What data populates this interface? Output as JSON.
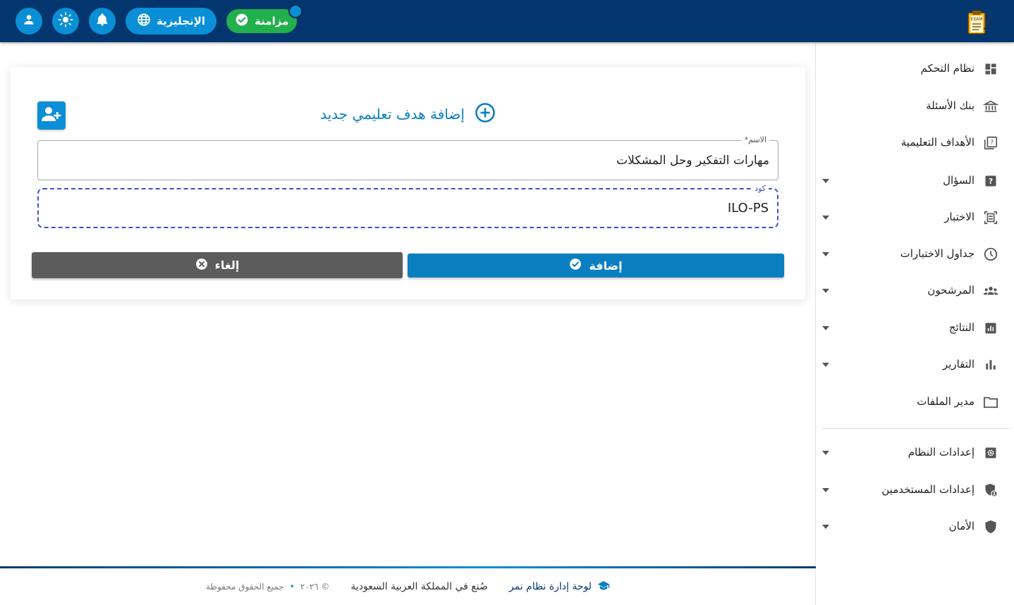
{
  "header": {
    "sync_label": "مزامنة",
    "language_label": "الإنجليزية",
    "icons": [
      "user-icon",
      "sun-icon",
      "bell-icon",
      "globe-icon",
      "check-circle-icon"
    ]
  },
  "sidebar": {
    "items": [
      {
        "label": "نظام التحكم",
        "icon": "dashboard-icon",
        "has_submenu": false
      },
      {
        "label": "بنك الأسئلة",
        "icon": "bank-icon",
        "has_submenu": false
      },
      {
        "label": "الأهداف التعليمية",
        "icon": "book-question-icon",
        "has_submenu": false
      },
      {
        "label": "السؤال",
        "icon": "question-icon",
        "has_submenu": true
      },
      {
        "label": "الاختبار",
        "icon": "exam-icon",
        "has_submenu": true
      },
      {
        "label": "جداول الاختبارات",
        "icon": "clock-icon",
        "has_submenu": true
      },
      {
        "label": "المرشحون",
        "icon": "group-icon",
        "has_submenu": true
      },
      {
        "label": "النتائج",
        "icon": "results-chart-icon",
        "has_submenu": true
      },
      {
        "label": "التقارير",
        "icon": "bar-chart-icon",
        "has_submenu": true
      },
      {
        "label": "مدير الملفات",
        "icon": "folder-icon",
        "has_submenu": false
      },
      {
        "label": "إعدادات النظام",
        "icon": "gear-icon",
        "has_submenu": true
      },
      {
        "label": "إعدادات المستخدمين",
        "icon": "user-shield-icon",
        "has_submenu": true
      },
      {
        "label": "الأمان",
        "icon": "shield-icon",
        "has_submenu": true
      }
    ]
  },
  "form": {
    "title": "إضافة هدف تعليمي جديد",
    "name_label": "الاسم*",
    "name_value": "مهارات التفكير وحل المشكلات",
    "code_label": "كود",
    "code_value": "ILO-PS",
    "add_label": "إضافة",
    "cancel_label": "إلغاء"
  },
  "footer": {
    "brand": "لوحة إدارة نظام نمر",
    "made_in": "صُنع في المملكة العربية السعودية",
    "year": "© ٢٠٢٦",
    "rights": "جميع الحقوق محفوظة"
  },
  "colors": {
    "header_bg": "#03366e",
    "accent": "#0a8fd6",
    "primary_button": "#0a7fbf",
    "cancel_button": "#5c5c5c",
    "sync_green": "#21b04b",
    "focus_outline": "#3a4fd6"
  }
}
